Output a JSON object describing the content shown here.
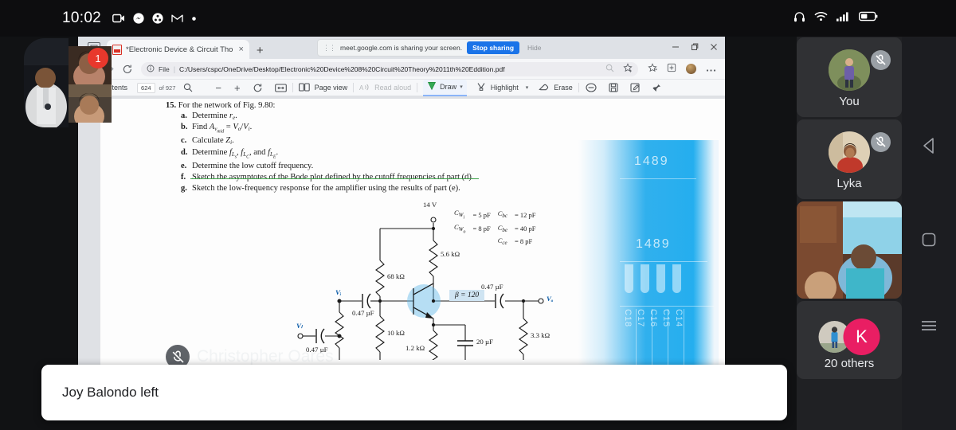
{
  "status_bar": {
    "clock": "10:02",
    "app_icons": [
      "camera-icon",
      "messenger-icon",
      "share-icon",
      "gmail-icon",
      "dot-icon"
    ],
    "right_icons": [
      "headphones-icon",
      "wifi-icon",
      "signal-bars-icon",
      "battery-icon"
    ]
  },
  "browser": {
    "tab": {
      "title": "*Electronic Device & Circuit Tho",
      "close_label": "×",
      "favicon": "pdf-file-icon"
    },
    "new_tab_label": "+",
    "tab_list_icon": "tab-search-icon",
    "share_notice": {
      "message": "meet.google.com is sharing your screen.",
      "stop_label": "Stop sharing",
      "hide_label": "Hide"
    },
    "window_controls": {
      "minimize": "—",
      "restore": "❐",
      "close": "✕"
    },
    "omnibox": {
      "file_label": "File",
      "separator": "|",
      "url": "C:/Users/cspc/OneDrive/Desktop/Electronic%20Device%208%20Circuit%20Theory%2011th%20Eddition.pdf"
    },
    "nav_icons": [
      "back-arrow-icon",
      "forward-arrow-icon",
      "reload-icon"
    ],
    "omni_right_icons": [
      "zoom-icon",
      "favorite-add-icon"
    ],
    "toolbar_right_icons": [
      "collections-icon",
      "extensions-icon",
      "profile-avatar",
      "more-options-icon"
    ]
  },
  "pdf_toolbar": {
    "contents_label": "Contents",
    "page_current": "624",
    "page_total": "of 927",
    "search_icon": "search-icon",
    "zoom_out": "−",
    "zoom_in": "+",
    "rotate_icon": "rotate-icon",
    "fit_icon": "fit-page-icon",
    "page_view_label": "Page view",
    "read_aloud_label": "Read aloud",
    "draw_label": "Draw",
    "highlight_label": "Highlight",
    "erase_label": "Erase",
    "right_icons": [
      "minus-circle-icon",
      "save-icon",
      "annotate-icon",
      "pin-icon"
    ]
  },
  "pdf_content": {
    "question_number": "15.",
    "question_title": "For the network of Fig. 9.80:",
    "items": [
      {
        "letter": "a.",
        "text": "Determine r",
        "sub": "e",
        "suffix": "."
      },
      {
        "letter": "b.",
        "text": "Find A",
        "sub": "vmid",
        "suffix": " = V",
        "sub2": "o",
        "suffix2": "/V",
        "sub3": "i",
        "suffix3": "."
      },
      {
        "letter": "c.",
        "text": "Calculate Z",
        "sub": "i",
        "suffix": "."
      },
      {
        "letter": "d.",
        "text": "Determine f",
        "sub": "Ls",
        "suffix": ", f",
        "sub2": "LC",
        "suffix2": ", and f",
        "sub3": "LE",
        "suffix3": "."
      },
      {
        "letter": "e.",
        "text": "Determine the low cutoff frequency."
      },
      {
        "letter": "f.",
        "text": "Sketch the asymptotes of the Bode plot defined by the cutoff frequencies of part (d).",
        "struck": true
      },
      {
        "letter": "g.",
        "text": "Sketch the low-frequency response for the amplifier using the results of part (e)."
      }
    ],
    "circuit": {
      "supply": "14 V",
      "beta": "β = 120",
      "resistors": [
        "68 kΩ",
        "5.6 kΩ",
        "10 kΩ",
        "1.2 kΩ",
        "3.3 kΩ"
      ],
      "capacitors": [
        "0.47 µF",
        "0.47 µF",
        "0.47 µF",
        "20 µF"
      ],
      "node_labels": [
        "Vᵢ",
        "Vₒ",
        "Vₗ"
      ],
      "cap_table": [
        [
          "C",
          "Wi",
          "= 5 pF",
          "C",
          "bc",
          "= 12 pF"
        ],
        [
          "C",
          "Wo",
          "= 8 pF",
          "C",
          "be",
          "= 40 pF"
        ],
        [
          "",
          "",
          "",
          "C",
          "ce",
          "= 8 pF"
        ]
      ]
    }
  },
  "blue_artifact": {
    "numbers": [
      "1489",
      "1489"
    ],
    "column_labels": [
      "C18",
      "C17",
      "C16",
      "C15",
      "C14"
    ]
  },
  "presenter": {
    "name": "Christopher Oares",
    "mute_icon": "mic-off-icon"
  },
  "meet_sidebar": {
    "tiles": [
      {
        "name": "You",
        "muted": true,
        "avatar": "photo-avatar-you"
      },
      {
        "name": "Lyka",
        "muted": true,
        "avatar": "photo-avatar-lyka"
      },
      {
        "name": "",
        "muted": false,
        "avatar": "video-feed-participant"
      },
      {
        "name": "20 others",
        "muted": false,
        "avatar": "photo-avatar-group",
        "badge_letter": "K",
        "badge_color": "#e91e63"
      }
    ]
  },
  "nav_bar": {
    "back": "back-triangle-icon",
    "home": "home-square-icon",
    "recents": "recents-lines-icon"
  },
  "pip": {
    "badge_count": "1"
  },
  "toast": {
    "message": "Joy Balondo left"
  }
}
